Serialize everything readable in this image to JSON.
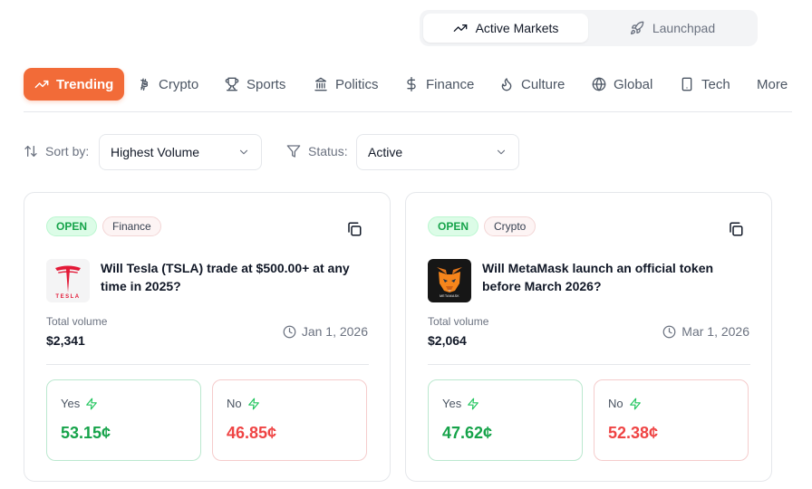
{
  "switcher": {
    "active_label": "Active Markets",
    "inactive_label": "Launchpad"
  },
  "tabs": [
    {
      "label": "Trending",
      "icon": "trending-up-icon"
    },
    {
      "label": "Crypto",
      "icon": "bitcoin-icon"
    },
    {
      "label": "Sports",
      "icon": "trophy-icon"
    },
    {
      "label": "Politics",
      "icon": "landmark-icon"
    },
    {
      "label": "Finance",
      "icon": "dollar-icon"
    },
    {
      "label": "Culture",
      "icon": "flame-icon"
    },
    {
      "label": "Global",
      "icon": "globe-icon"
    },
    {
      "label": "Tech",
      "icon": "smartphone-icon"
    },
    {
      "label": "More"
    }
  ],
  "filters": {
    "sort_label": "Sort by:",
    "sort_value": "Highest Volume",
    "status_label": "Status:",
    "status_value": "Active"
  },
  "cards": [
    {
      "status": "OPEN",
      "category": "Finance",
      "question": "Will Tesla (TSLA) trade at $500.00+ at any time in 2025?",
      "logo_text": "TESLA",
      "volume_label": "Total volume",
      "volume": "$2,341",
      "date": "Jan 1, 2026",
      "yes_label": "Yes",
      "yes_price": "53.15¢",
      "no_label": "No",
      "no_price": "46.85¢"
    },
    {
      "status": "OPEN",
      "category": "Crypto",
      "question": "Will MetaMask launch an official token before March 2026?",
      "logo_text": "METAMASK",
      "volume_label": "Total volume",
      "volume": "$2,064",
      "date": "Mar 1, 2026",
      "yes_label": "Yes",
      "yes_price": "47.62¢",
      "no_label": "No",
      "no_price": "52.38¢"
    }
  ],
  "colors": {
    "accent": "#f26b38",
    "yes": "#16a34a",
    "no": "#ef4444",
    "tesla_red": "#e31937"
  }
}
